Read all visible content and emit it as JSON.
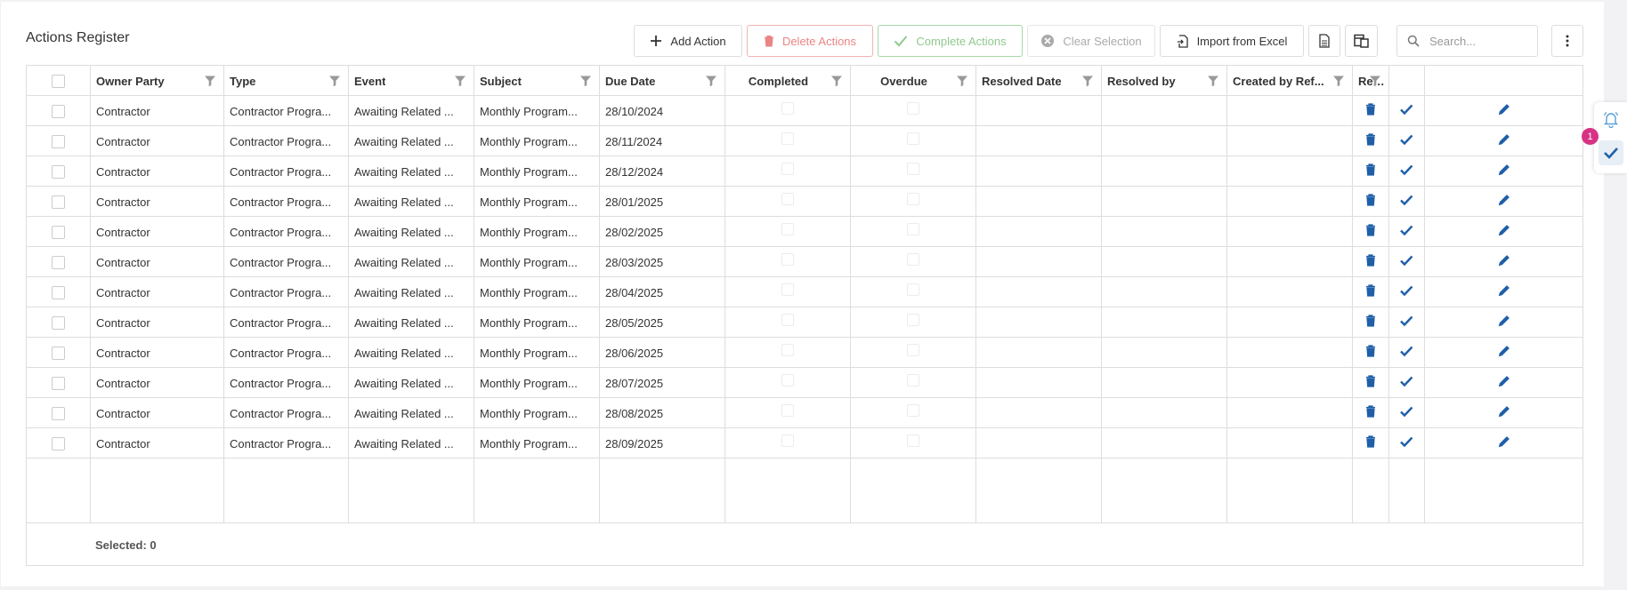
{
  "page": {
    "title": "Actions Register"
  },
  "toolbar": {
    "add_label": "Add Action",
    "delete_label": "Delete Actions",
    "complete_label": "Complete Actions",
    "clear_label": "Clear Selection",
    "import_label": "Import from Excel"
  },
  "search": {
    "placeholder": "Search...",
    "value": ""
  },
  "grid": {
    "columns": [
      "Owner Party",
      "Type",
      "Event",
      "Subject",
      "Due Date",
      "Completed",
      "Overdue",
      "Resolved Date",
      "Resolved by",
      "Created by Ref...",
      "Resolved by Re..."
    ],
    "rows": [
      {
        "owner": "Contractor",
        "type": "Contractor Progra...",
        "event": "Awaiting Related ...",
        "subject": "Monthly Program...",
        "due": "28/10/2024"
      },
      {
        "owner": "Contractor",
        "type": "Contractor Progra...",
        "event": "Awaiting Related ...",
        "subject": "Monthly Program...",
        "due": "28/11/2024"
      },
      {
        "owner": "Contractor",
        "type": "Contractor Progra...",
        "event": "Awaiting Related ...",
        "subject": "Monthly Program...",
        "due": "28/12/2024"
      },
      {
        "owner": "Contractor",
        "type": "Contractor Progra...",
        "event": "Awaiting Related ...",
        "subject": "Monthly Program...",
        "due": "28/01/2025"
      },
      {
        "owner": "Contractor",
        "type": "Contractor Progra...",
        "event": "Awaiting Related ...",
        "subject": "Monthly Program...",
        "due": "28/02/2025"
      },
      {
        "owner": "Contractor",
        "type": "Contractor Progra...",
        "event": "Awaiting Related ...",
        "subject": "Monthly Program...",
        "due": "28/03/2025"
      },
      {
        "owner": "Contractor",
        "type": "Contractor Progra...",
        "event": "Awaiting Related ...",
        "subject": "Monthly Program...",
        "due": "28/04/2025"
      },
      {
        "owner": "Contractor",
        "type": "Contractor Progra...",
        "event": "Awaiting Related ...",
        "subject": "Monthly Program...",
        "due": "28/05/2025"
      },
      {
        "owner": "Contractor",
        "type": "Contractor Progra...",
        "event": "Awaiting Related ...",
        "subject": "Monthly Program...",
        "due": "28/06/2025"
      },
      {
        "owner": "Contractor",
        "type": "Contractor Progra...",
        "event": "Awaiting Related ...",
        "subject": "Monthly Program...",
        "due": "28/07/2025"
      },
      {
        "owner": "Contractor",
        "type": "Contractor Progra...",
        "event": "Awaiting Related ...",
        "subject": "Monthly Program...",
        "due": "28/08/2025"
      },
      {
        "owner": "Contractor",
        "type": "Contractor Progra...",
        "event": "Awaiting Related ...",
        "subject": "Monthly Program...",
        "due": "28/09/2025"
      }
    ]
  },
  "footer": {
    "selected_text": "Selected: 0"
  },
  "side": {
    "badge_count": "1"
  },
  "colors": {
    "accent": "#1f5fa8",
    "danger": "#e98585",
    "success": "#8fc98f",
    "badge": "#d63384"
  }
}
